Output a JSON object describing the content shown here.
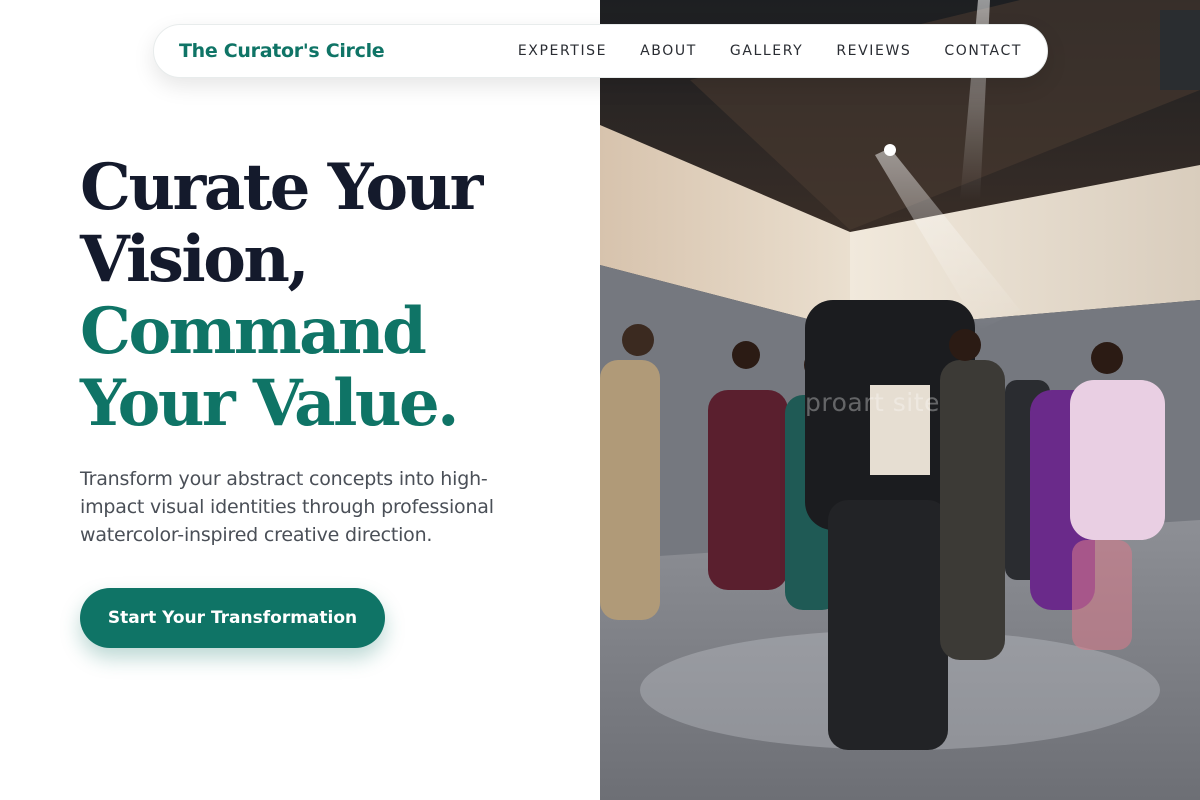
{
  "brand": {
    "name": "The Curator's Circle"
  },
  "nav": {
    "items": [
      {
        "label": "EXPERTISE"
      },
      {
        "label": "ABOUT"
      },
      {
        "label": "GALLERY"
      },
      {
        "label": "REVIEWS"
      },
      {
        "label": "CONTACT"
      }
    ]
  },
  "hero": {
    "headline_line1": "Curate Your",
    "headline_line2": "Vision,",
    "headline_line3": "Command",
    "headline_line4": "Your Value.",
    "subtitle": "Transform your abstract concepts into high-impact visual identities through professional watercolor-inspired creative direction.",
    "cta_label": "Start Your Transformation"
  },
  "photo": {
    "watermark": "proart site"
  },
  "colors": {
    "accent": "#0f7466",
    "heading_dark": "#141a2c",
    "body_text": "#4a4f57",
    "background": "#ffffff"
  }
}
